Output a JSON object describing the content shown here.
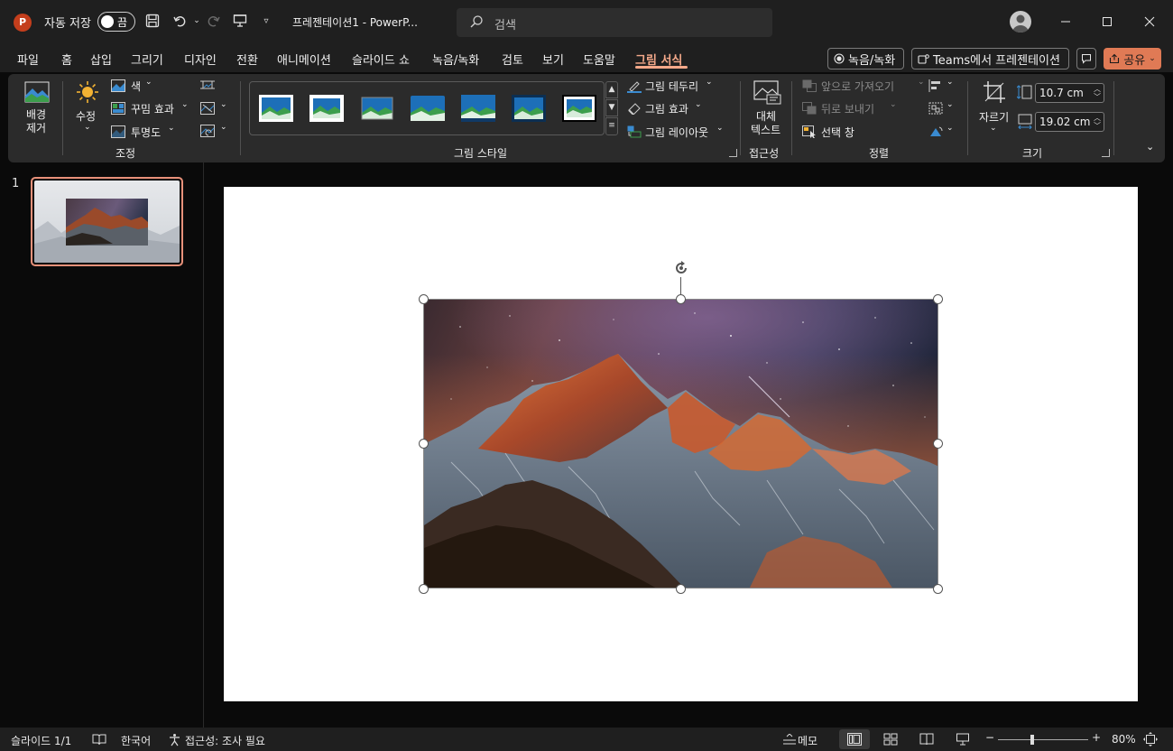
{
  "titlebar": {
    "app_logo": "P",
    "autosave_label": "자동 저장",
    "autosave_state": "끔",
    "doc_title": "프레젠테이션1  -  PowerP...",
    "search_placeholder": "검색"
  },
  "menu": {
    "items": [
      "파일",
      "홈",
      "삽입",
      "그리기",
      "디자인",
      "전환",
      "애니메이션",
      "슬라이드 쇼",
      "녹음/녹화",
      "검토",
      "보기",
      "도움말",
      "그림 서식"
    ],
    "record_button": "녹음/녹화",
    "teams_button": "Teams에서 프레젠테이션",
    "share_button": "공유"
  },
  "ribbon": {
    "remove_bg": [
      "배경",
      "제거"
    ],
    "corrections": "수정",
    "color": "색",
    "artistic_effects": "꾸밈 효과",
    "transparency": "투명도",
    "group_adjust": "조정",
    "group_picture_styles": "그림 스타일",
    "picture_border": "그림 테두리",
    "picture_effects": "그림 효과",
    "picture_layout": "그림 레이아웃",
    "alt_text": [
      "대체",
      "텍스트"
    ],
    "group_accessibility": "접근성",
    "bring_forward": "앞으로 가져오기",
    "send_backward": "뒤로 보내기",
    "selection_pane": "선택 창",
    "group_arrange": "정렬",
    "crop": "자르기",
    "height": "10.7 cm",
    "width": "19.02 cm",
    "group_size": "크기"
  },
  "thumbnails": {
    "slide_number": "1"
  },
  "status": {
    "slide_info": "슬라이드 1/1",
    "language": "한국어",
    "accessibility": "접근성: 조사 필요",
    "notes": "메모",
    "zoom": "80%"
  },
  "colors": {
    "accent": "#f4a98a",
    "share_bg": "#e07a55",
    "app_red": "#c43e1c"
  }
}
